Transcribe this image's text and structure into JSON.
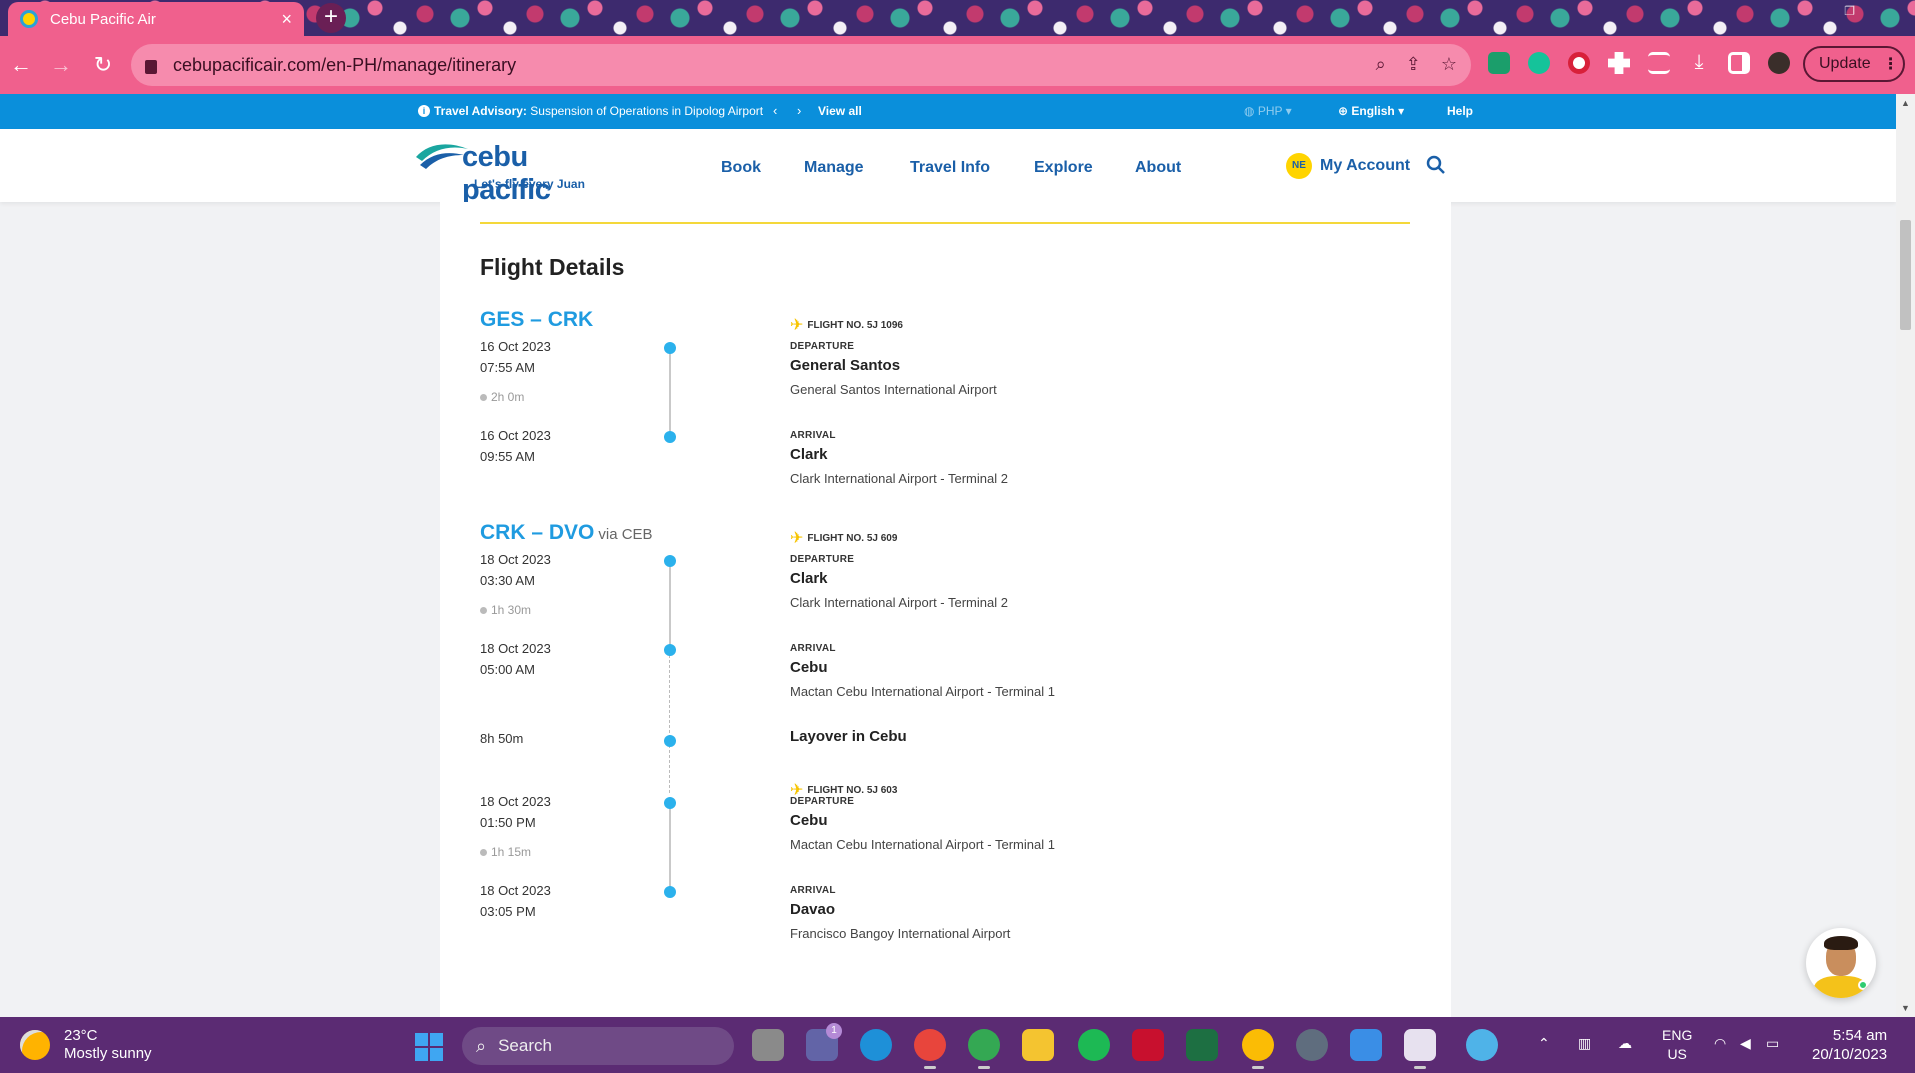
{
  "browser": {
    "tab_title": "Cebu Pacific Air",
    "tab_close": "×",
    "new_tab": "+",
    "url": "cebupacificair.com/en-PH/manage/itinerary",
    "update_label": "Update"
  },
  "advisory": {
    "label": "Travel Advisory:",
    "message": "Suspension of Operations in Dipolog Airport",
    "prev": "‹",
    "next": "›",
    "view_all": "View all",
    "currency": "PHP",
    "language": "English",
    "help": "Help"
  },
  "header": {
    "brand": "cebu pacific",
    "tagline": "Let's fly every Juan",
    "nav": [
      "Book",
      "Manage",
      "Travel Info",
      "Explore",
      "About"
    ],
    "account_initials": "NE",
    "account_label": "My Account"
  },
  "flight_details": {
    "title": "Flight Details",
    "segments": [
      {
        "route": "GES – CRK",
        "via": "",
        "flight_no": "FLIGHT NO. 5J 1096",
        "departure": {
          "label": "DEPARTURE",
          "date": "16 Oct 2023",
          "time": "07:55 AM",
          "city": "General Santos",
          "airport": "General Santos International Airport"
        },
        "duration": "2h 0m",
        "arrival": {
          "label": "ARRIVAL",
          "date": "16 Oct 2023",
          "time": "09:55 AM",
          "city": "Clark",
          "airport": "Clark International Airport - Terminal 2"
        }
      },
      {
        "route": "CRK – DVO",
        "via": "via CEB",
        "flight_no": "FLIGHT NO. 5J 609",
        "departure": {
          "label": "DEPARTURE",
          "date": "18 Oct 2023",
          "time": "03:30 AM",
          "city": "Clark",
          "airport": "Clark International Airport - Terminal 2"
        },
        "duration": "1h 30m",
        "arrival": {
          "label": "ARRIVAL",
          "date": "18 Oct 2023",
          "time": "05:00 AM",
          "city": "Cebu",
          "airport": "Mactan Cebu International Airport - Terminal 1"
        },
        "layover": {
          "duration": "8h 50m",
          "label": "Layover in Cebu"
        },
        "leg2": {
          "flight_no": "FLIGHT NO. 5J 603",
          "departure": {
            "label": "DEPARTURE",
            "date": "18 Oct 2023",
            "time": "01:50 PM",
            "city": "Cebu",
            "airport": "Mactan Cebu International Airport - Terminal 1"
          },
          "duration": "1h 15m",
          "arrival": {
            "label": "ARRIVAL",
            "date": "18 Oct 2023",
            "time": "03:05 PM",
            "city": "Davao",
            "airport": "Francisco Bangoy International Airport"
          }
        }
      }
    ]
  },
  "taskbar": {
    "temperature": "23°C",
    "weather": "Mostly sunny",
    "search_placeholder": "Search",
    "teams_badge": "1",
    "lang_line1": "ENG",
    "lang_line2": "US",
    "time": "5:54 am",
    "date": "20/10/2023"
  },
  "colors": {
    "brand_blue": "#1a5fa8",
    "accent_cyan": "#1f9be0",
    "advisory_bar": "#0a8fdb",
    "browser_pink": "#f0608d",
    "taskbar_purple": "#5b2b73"
  }
}
